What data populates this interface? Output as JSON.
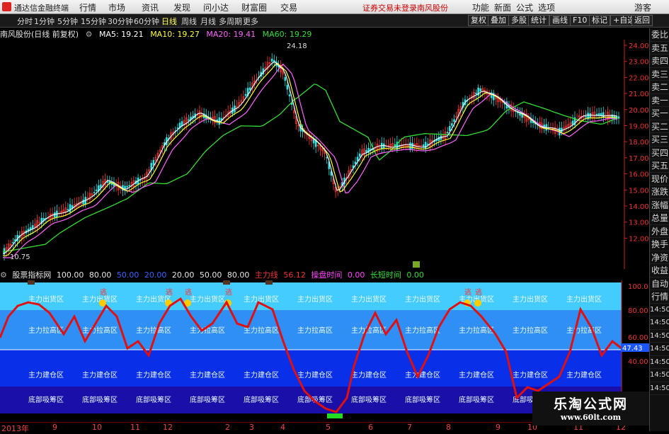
{
  "titlebar": {
    "app_title": "通达信金融终端",
    "menus": [
      "行情",
      "市场",
      "资讯",
      "发现",
      "问小达",
      "财富圈",
      "交易"
    ],
    "status_text": "证券交易未登录",
    "stock_name": "南风股份",
    "right_menus": [
      "功能",
      "新面",
      "公式",
      "选项"
    ],
    "guest": "游客"
  },
  "toolbar": {
    "periods": [
      "分时",
      "1分钟",
      "5分钟",
      "15分钟",
      "30分钟",
      "60分钟",
      "日线",
      "周线",
      "月线",
      "多周期",
      "更多"
    ],
    "active_period": "日线",
    "right_buttons": [
      "复权",
      "叠加",
      "多股",
      "统计",
      "画线",
      "F10",
      "标记",
      "+自选",
      "返回"
    ]
  },
  "chart_header": {
    "title": "南风股份(日线 前复权)",
    "ma5": "MA5: 19.21",
    "ma10": "MA10: 19.27",
    "ma20": "MA20: 19.41",
    "ma60": "MA60: 19.29"
  },
  "main_chart": {
    "price_labels": [
      "24.00",
      "23.00",
      "22.00",
      "21.00",
      "20.00",
      "19.00",
      "18.00",
      "17.00",
      "16.00",
      "15.00",
      "14.00",
      "13.00",
      "12.00"
    ],
    "high_marker": "24.18",
    "low_marker": "10.75"
  },
  "indicator": {
    "name": "股票指标网",
    "params": [
      "100.00",
      "80.00",
      "50.00",
      "20.00",
      "20.00",
      "50.00",
      "80.00"
    ],
    "label_main": "主力线",
    "value_main": "56.12",
    "label_op": "操盘时间",
    "value_op": "0.00",
    "label_long": "长短时间",
    "value_long": "0.00",
    "scale": [
      "100.0",
      "80.00",
      "60.00",
      "40.00"
    ],
    "current_value": "47.43",
    "zones": {
      "top": "主力出货区",
      "upper": "主力拉高区",
      "middle": "主力建仓区",
      "bottom": "底部吸筹区"
    },
    "escape_label": "逃",
    "series_color": "#e01010"
  },
  "right_sidebar": [
    "委比",
    "卖五",
    "卖四",
    "卖三",
    "卖二",
    "卖一",
    "买一",
    "买二",
    "买三",
    "买四",
    "买五",
    "现价",
    "涨跌",
    "涨幅",
    "总量",
    "外盘",
    "换手",
    "净资",
    "收益",
    "自动",
    "行情",
    "14:50",
    "14:50",
    "14:50",
    "14:50",
    "14:50",
    "14:50",
    "14:50"
  ],
  "xaxis": [
    "2013年",
    "9",
    "10",
    "11",
    "12",
    "2",
    "3",
    "4",
    "5",
    "6",
    "7",
    "8",
    "9",
    "10",
    "11",
    "12"
  ],
  "watermark": {
    "line1": "乐淘公式网",
    "line2": "www.60lt.com"
  },
  "colors": {
    "ma5": "#ffffff",
    "ma10": "#ffff33",
    "ma20": "#ff66ff",
    "ma60": "#33dd33",
    "axis": "#cc2222"
  }
}
